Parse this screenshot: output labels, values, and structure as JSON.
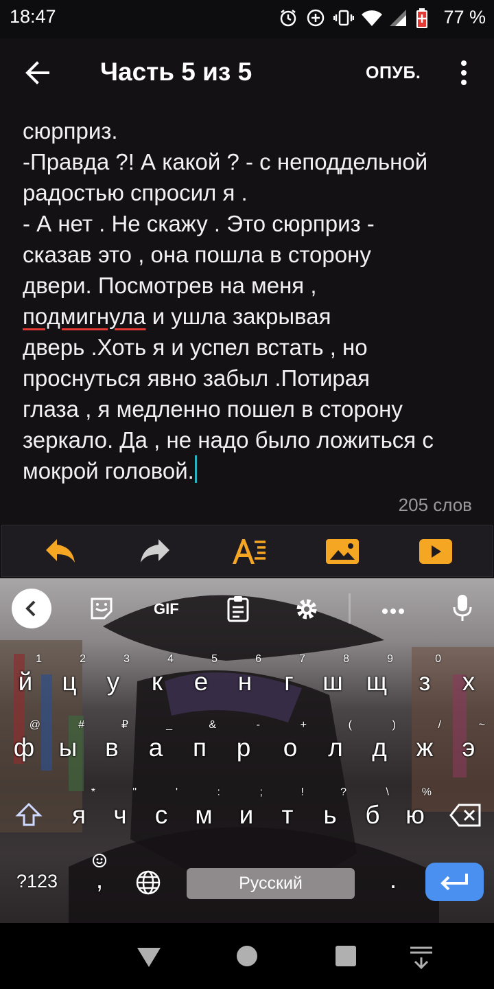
{
  "status_bar": {
    "time": "18:47",
    "battery_percent": "77 %"
  },
  "app_bar": {
    "title": "Часть 5 из 5",
    "publish_label": "ОПУБ."
  },
  "editor": {
    "lines": [
      "сюрприз.",
      "-Правда ?! А какой ? - с неподдельной",
      "радостью спросил я .",
      "- А нет . Не скажу . Это сюрприз -",
      "сказав это , она пошла в сторону",
      "двери. Посмотрев на меня ,",
      "и ушла закрывая",
      "дверь .Хоть я и успел встать , но",
      "проснуться явно забыл .Потирая",
      "глаза , я медленно пошел в сторону",
      "зеркало. Да , не надо было ложиться с",
      "мокрой головой."
    ],
    "misspelled_word": "подмигнула",
    "word_count": "205 слов"
  },
  "toolbar": {
    "accent_color": "#f5a623",
    "icons": [
      "undo-icon",
      "redo-icon",
      "text-format-icon",
      "image-icon",
      "video-icon"
    ]
  },
  "keyboard": {
    "suggestion_icons": [
      "back-icon",
      "sticker-icon",
      "gif-icon",
      "clipboard-icon",
      "settings-icon",
      "more-icon",
      "mic-icon"
    ],
    "gif_label": "GIF",
    "row1": [
      {
        "key": "й",
        "hint": "1"
      },
      {
        "key": "ц",
        "hint": "2"
      },
      {
        "key": "у",
        "hint": "3"
      },
      {
        "key": "к",
        "hint": "4"
      },
      {
        "key": "е",
        "hint": "5"
      },
      {
        "key": "н",
        "hint": "6"
      },
      {
        "key": "г",
        "hint": "7"
      },
      {
        "key": "ш",
        "hint": "8"
      },
      {
        "key": "щ",
        "hint": "9"
      },
      {
        "key": "з",
        "hint": "0"
      },
      {
        "key": "х",
        "hint": ""
      }
    ],
    "row2": [
      {
        "key": "ф",
        "hint": "@"
      },
      {
        "key": "ы",
        "hint": "#"
      },
      {
        "key": "в",
        "hint": "₽"
      },
      {
        "key": "а",
        "hint": "_"
      },
      {
        "key": "п",
        "hint": "&"
      },
      {
        "key": "р",
        "hint": "-"
      },
      {
        "key": "о",
        "hint": "+"
      },
      {
        "key": "л",
        "hint": "("
      },
      {
        "key": "д",
        "hint": ")"
      },
      {
        "key": "ж",
        "hint": "/"
      },
      {
        "key": "э",
        "hint": "~"
      }
    ],
    "row3": [
      {
        "key": "я",
        "hint": "*"
      },
      {
        "key": "ч",
        "hint": "\""
      },
      {
        "key": "с",
        "hint": "'"
      },
      {
        "key": "м",
        "hint": ":"
      },
      {
        "key": "и",
        "hint": ";"
      },
      {
        "key": "т",
        "hint": "!"
      },
      {
        "key": "ь",
        "hint": "?"
      },
      {
        "key": "б",
        "hint": "\\"
      },
      {
        "key": "ю",
        "hint": "%"
      }
    ],
    "symbols_label": "?123",
    "comma_label": ",",
    "period_label": ".",
    "space_label": "Русский",
    "enter_color": "#4a90f0"
  }
}
